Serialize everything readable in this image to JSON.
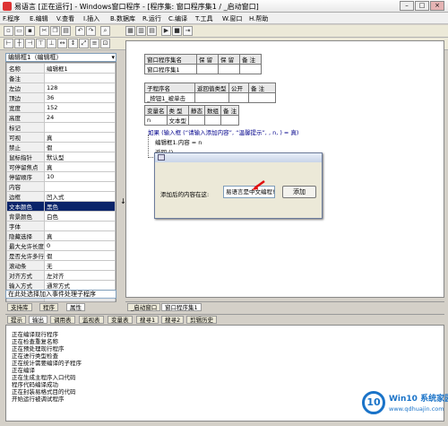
{
  "window": {
    "title": "易语言 [正在运行] - Windows窗口程序 - [程序集: 窗口程序集1 / _启动窗口]"
  },
  "menu": [
    "F.程序",
    "E.编辑",
    "V.查看",
    "I.插入",
    "B.数据库",
    "R.运行",
    "C.编译",
    "T.工具",
    "W.窗口",
    "H.帮助"
  ],
  "toolbar": {
    "selector_value": "编辑框1（编辑框）",
    "combo1": "",
    "combo2": ""
  },
  "properties": [
    [
      "名称",
      "编辑框1"
    ],
    [
      "备注",
      ""
    ],
    [
      "左边",
      "128"
    ],
    [
      "顶边",
      "36"
    ],
    [
      "宽度",
      "152"
    ],
    [
      "高度",
      "24"
    ],
    [
      "标记",
      ""
    ],
    [
      "可视",
      "真"
    ],
    [
      "禁止",
      "假"
    ],
    [
      "鼠标指针",
      "默认型"
    ],
    [
      "可停留焦点",
      "真"
    ],
    [
      "停留顺序",
      "10"
    ],
    [
      "内容",
      ""
    ],
    [
      "边框",
      "凹入式"
    ],
    [
      "文本颜色",
      "黑色"
    ],
    [
      "背景颜色",
      "白色"
    ],
    [
      "字体",
      ""
    ],
    [
      "隐藏选择",
      "真"
    ],
    [
      "最大允许长度",
      "0"
    ],
    [
      "是否允许多行",
      "假"
    ],
    [
      "滚动条",
      "无"
    ],
    [
      "对齐方式",
      "左对齐"
    ],
    [
      "输入方式",
      "通常方式"
    ],
    [
      "密码遮盖字符",
      "*"
    ],
    [
      "转换方式",
      "无"
    ]
  ],
  "event_combo": "在此处选择加入事件处理子程序",
  "left_tabs": [
    "支持库",
    "程序",
    "属性"
  ],
  "editor": {
    "assembly_header": [
      "窗口程序集名",
      "保 留",
      "保 留",
      "备 注"
    ],
    "assembly_row": [
      "窗口程序集1",
      "",
      "",
      ""
    ],
    "sub_header": [
      "子程序名",
      "返回值类型",
      "公开",
      "备 注"
    ],
    "sub_row": [
      "_按钮1_被单击",
      "",
      "",
      ""
    ],
    "var_header": [
      "变量名",
      "类 型",
      "静态",
      "数组",
      "备 注"
    ],
    "var_row": [
      "n",
      "文本型",
      "",
      "",
      ""
    ],
    "code_lines": [
      "如果 (输入框 (“请输入添加内容”, “温馨提示”, , n, ) = 真)",
      "编辑框1.内容 = n",
      "返回 ()"
    ]
  },
  "dialog": {
    "label": "添加后的内容在这:",
    "input_value": "易语言是中文编程!",
    "button": "添加"
  },
  "editor_tabs": [
    "_启动窗口",
    "窗口程序集1"
  ],
  "output_tabs": [
    "提示",
    "输出",
    "调用表",
    "监视表",
    "变量表",
    "搜寻1",
    "搜寻2",
    "剪辑历史"
  ],
  "output_lines": [
    "正在编译现行程序",
    "正在检查重复名称",
    "正在预处理现行程序",
    "正在进行类型检查",
    "正在统计需要编译的子程序",
    "正在编译",
    "正在生成主程序入口代码",
    "程序代码编译成功",
    "正在封装易格式目的代码",
    "开始运行被调试程序"
  ],
  "watermark": {
    "brand": "Win10 系统家园",
    "url": "www.qdhuajin.com"
  },
  "colors": {
    "title_accent": "#0a246a",
    "logo_blue": "#1a73c8"
  }
}
